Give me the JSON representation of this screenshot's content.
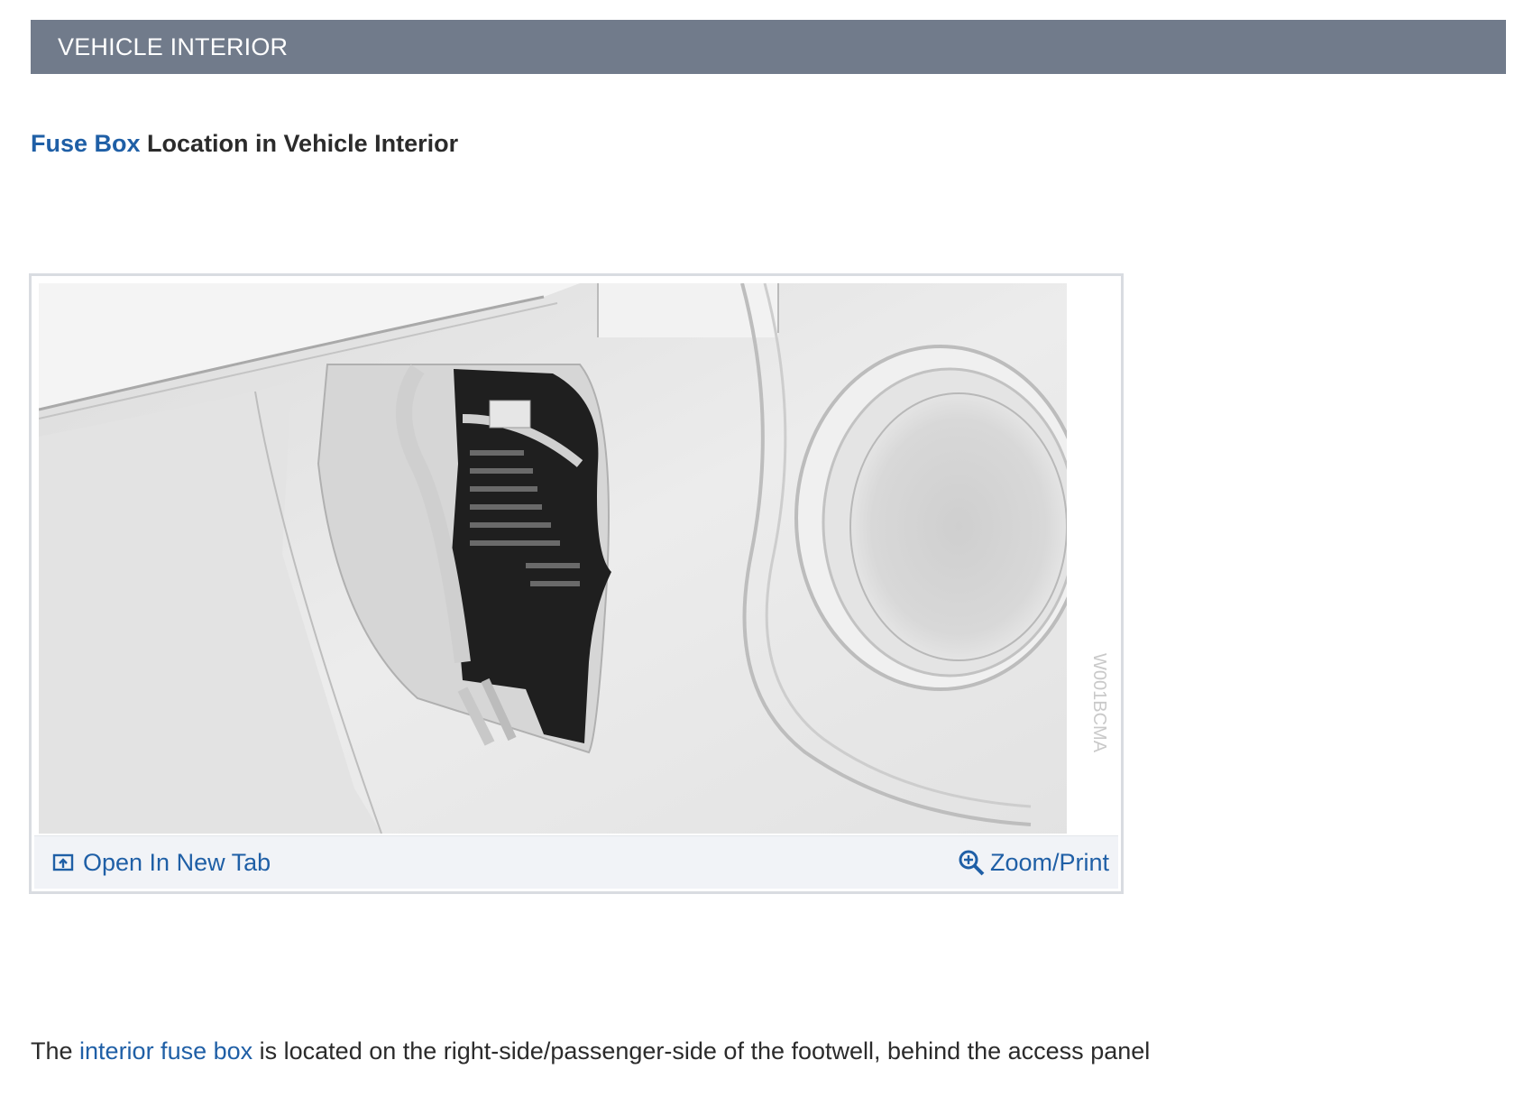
{
  "header": {
    "title": "VEHICLE INTERIOR"
  },
  "subtitle": {
    "link_text": "Fuse Box",
    "rest_text": "Location in Vehicle Interior"
  },
  "figure": {
    "watermark": "W001BCMA",
    "open_tab_label": "Open In New Tab",
    "open_tab_icon": "open-new-tab-icon",
    "zoom_label": "Zoom/Print",
    "zoom_icon": "zoom-in-icon"
  },
  "description": {
    "before": "The ",
    "link_text": "interior fuse box",
    "after": " is located on the right-side/passenger-side of the footwell, behind the access panel"
  },
  "colors": {
    "header_bg": "#717b8b",
    "link": "#1f5fa6",
    "bar_bg": "#f1f3f7"
  }
}
